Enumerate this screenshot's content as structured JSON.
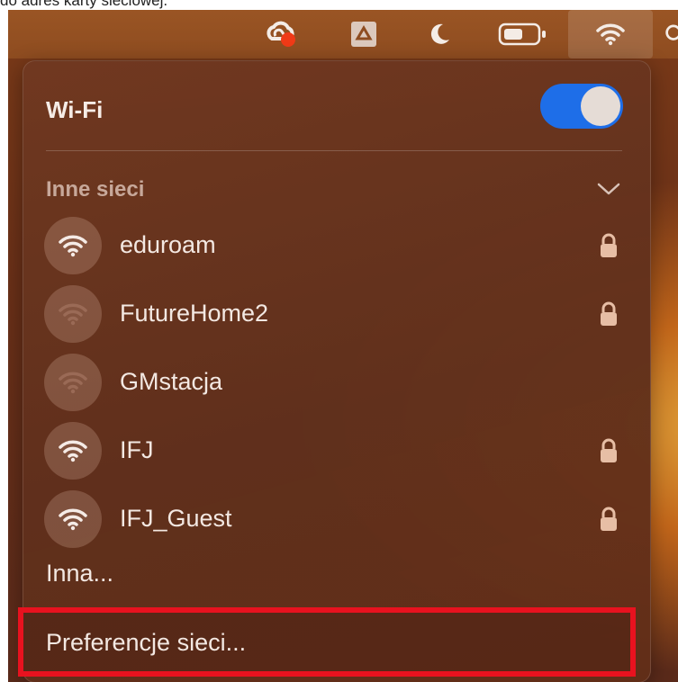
{
  "page_caption": "do adres karty sieciowej.",
  "menubar": {
    "icons": [
      "creative-cloud-icon",
      "google-drive-icon",
      "do-not-disturb-moon-icon",
      "battery-icon",
      "wifi-icon",
      "search-icon"
    ]
  },
  "wifi_menu": {
    "title": "Wi-Fi",
    "toggle_on": true,
    "section_label": "Inne sieci",
    "networks": [
      {
        "name": "eduroam",
        "locked": true,
        "strong": true
      },
      {
        "name": "FutureHome2",
        "locked": true,
        "strong": false
      },
      {
        "name": "GMstacja",
        "locked": false,
        "strong": false
      },
      {
        "name": "IFJ",
        "locked": true,
        "strong": true
      },
      {
        "name": "IFJ_Guest",
        "locked": true,
        "strong": true
      }
    ],
    "other_label": "Inna...",
    "preferences_label": "Preferencje sieci..."
  },
  "colors": {
    "toggle_on": "#1e6ee8",
    "highlight": "#e8121f",
    "wifi_strong": "#f5ebe6",
    "wifi_weak": "#9a6a56",
    "lock": "#e7bea5"
  }
}
